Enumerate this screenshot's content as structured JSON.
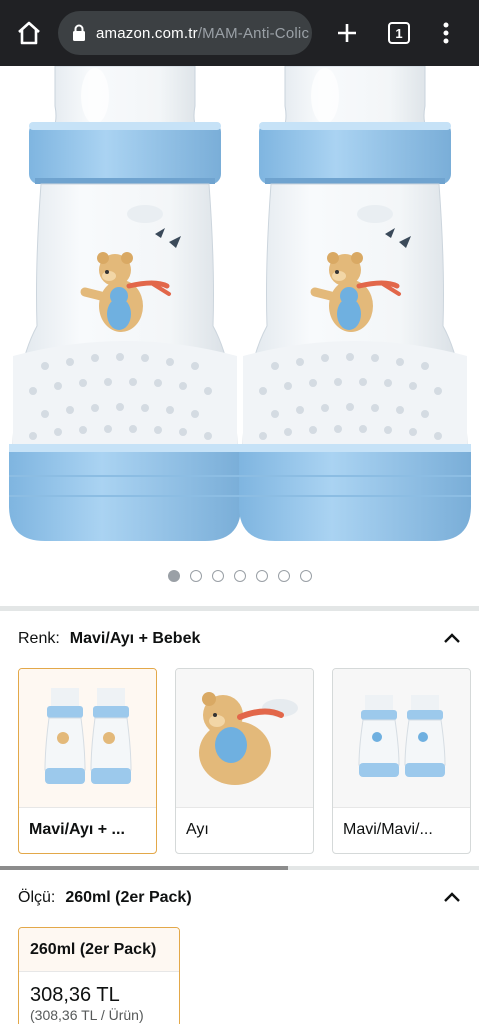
{
  "browser": {
    "url_domain": "amazon.com.tr",
    "url_path": "/MAM-Anti-Colic",
    "tab_count": "1"
  },
  "gallery": {
    "image_count": 7,
    "active_index": 0
  },
  "color_selector": {
    "label": "Renk:",
    "value": "Mavi/Ayı + Bebek",
    "options": [
      {
        "label": "Mavi/Ayı + ...",
        "selected": true
      },
      {
        "label": "Ayı",
        "selected": false
      },
      {
        "label": "Mavi/Mavi/...",
        "selected": false
      }
    ]
  },
  "size_selector": {
    "label": "Ölçü:",
    "value": "260ml (2er Pack)",
    "options": [
      {
        "label": "260ml (2er Pack)",
        "price": "308,36 TL",
        "unit_price": "(308,36 TL / Ürün)",
        "selected": true
      }
    ]
  },
  "colors": {
    "accent": "#e3a849",
    "bottle_blue": "#9cc9ec",
    "chrome_bg": "#202124"
  }
}
